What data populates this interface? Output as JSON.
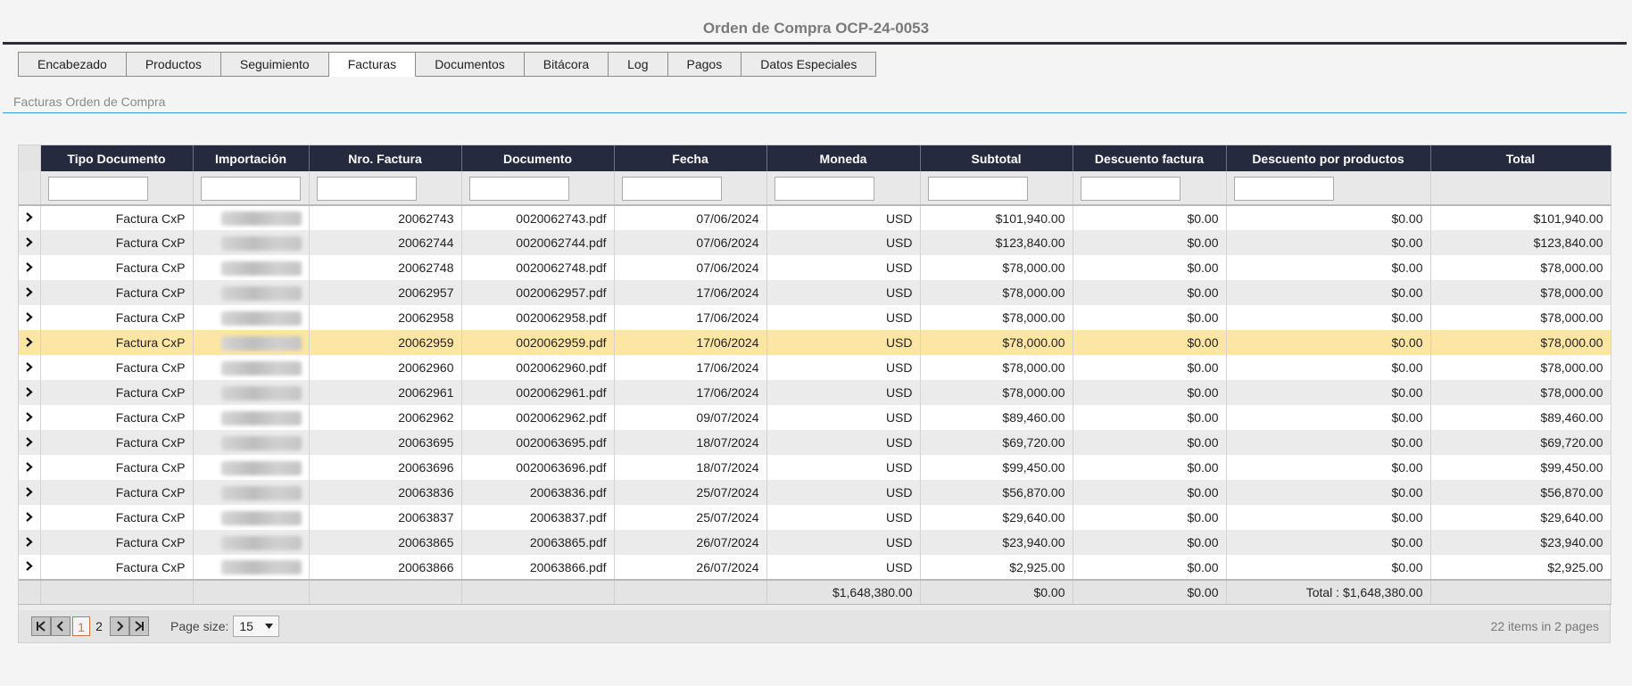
{
  "page": {
    "title": "Orden de Compra OCP-24-0053"
  },
  "tabs": [
    {
      "label": "Encabezado"
    },
    {
      "label": "Productos"
    },
    {
      "label": "Seguimiento"
    },
    {
      "label": "Facturas",
      "active": true
    },
    {
      "label": "Documentos"
    },
    {
      "label": "Bitácora"
    },
    {
      "label": "Log"
    },
    {
      "label": "Pagos"
    },
    {
      "label": "Datos Especiales"
    }
  ],
  "section": {
    "title": "Facturas Orden de Compra"
  },
  "grid": {
    "columns": [
      "Tipo Documento",
      "Importación",
      "Nro. Factura",
      "Documento",
      "Fecha",
      "Moneda",
      "Subtotal",
      "Descuento factura",
      "Descuento por productos",
      "Total"
    ],
    "expand_icon": "chevron-right-icon",
    "rows": [
      [
        "Factura CxP",
        "",
        "20062743",
        "0020062743.pdf",
        "07/06/2024",
        "USD",
        "$101,940.00",
        "$0.00",
        "$0.00",
        "$101,940.00"
      ],
      [
        "Factura CxP",
        "",
        "20062744",
        "0020062744.pdf",
        "07/06/2024",
        "USD",
        "$123,840.00",
        "$0.00",
        "$0.00",
        "$123,840.00"
      ],
      [
        "Factura CxP",
        "",
        "20062748",
        "0020062748.pdf",
        "07/06/2024",
        "USD",
        "$78,000.00",
        "$0.00",
        "$0.00",
        "$78,000.00"
      ],
      [
        "Factura CxP",
        "",
        "20062957",
        "0020062957.pdf",
        "17/06/2024",
        "USD",
        "$78,000.00",
        "$0.00",
        "$0.00",
        "$78,000.00"
      ],
      [
        "Factura CxP",
        "",
        "20062958",
        "0020062958.pdf",
        "17/06/2024",
        "USD",
        "$78,000.00",
        "$0.00",
        "$0.00",
        "$78,000.00"
      ],
      [
        "Factura CxP",
        "",
        "20062959",
        "0020062959.pdf",
        "17/06/2024",
        "USD",
        "$78,000.00",
        "$0.00",
        "$0.00",
        "$78,000.00"
      ],
      [
        "Factura CxP",
        "",
        "20062960",
        "0020062960.pdf",
        "17/06/2024",
        "USD",
        "$78,000.00",
        "$0.00",
        "$0.00",
        "$78,000.00"
      ],
      [
        "Factura CxP",
        "",
        "20062961",
        "0020062961.pdf",
        "17/06/2024",
        "USD",
        "$78,000.00",
        "$0.00",
        "$0.00",
        "$78,000.00"
      ],
      [
        "Factura CxP",
        "",
        "20062962",
        "0020062962.pdf",
        "09/07/2024",
        "USD",
        "$89,460.00",
        "$0.00",
        "$0.00",
        "$89,460.00"
      ],
      [
        "Factura CxP",
        "",
        "20063695",
        "0020063695.pdf",
        "18/07/2024",
        "USD",
        "$69,720.00",
        "$0.00",
        "$0.00",
        "$69,720.00"
      ],
      [
        "Factura CxP",
        "",
        "20063696",
        "0020063696.pdf",
        "18/07/2024",
        "USD",
        "$99,450.00",
        "$0.00",
        "$0.00",
        "$99,450.00"
      ],
      [
        "Factura CxP",
        "",
        "20063836",
        "20063836.pdf",
        "25/07/2024",
        "USD",
        "$56,870.00",
        "$0.00",
        "$0.00",
        "$56,870.00"
      ],
      [
        "Factura CxP",
        "",
        "20063837",
        "20063837.pdf",
        "25/07/2024",
        "USD",
        "$29,640.00",
        "$0.00",
        "$0.00",
        "$29,640.00"
      ],
      [
        "Factura CxP",
        "",
        "20063865",
        "20063865.pdf",
        "26/07/2024",
        "USD",
        "$23,940.00",
        "$0.00",
        "$0.00",
        "$23,940.00"
      ],
      [
        "Factura CxP",
        "",
        "20063866",
        "20063866.pdf",
        "26/07/2024",
        "USD",
        "$2,925.00",
        "$0.00",
        "$0.00",
        "$2,925.00"
      ]
    ],
    "selected_row_index": 5,
    "totals": {
      "subtotal": "$1,648,380.00",
      "descuento_factura": "$0.00",
      "descuento_productos": "$0.00",
      "total": "Total : $1,648,380.00"
    }
  },
  "pager": {
    "first_icon": "first-page-icon",
    "prev_icon": "prev-page-icon",
    "next_icon": "next-page-icon",
    "last_icon": "last-page-icon",
    "pages": [
      "1",
      "2"
    ],
    "current_page": "1",
    "page_size_label": "Page size:",
    "page_size": "15",
    "info": "22 items in 2 pages"
  },
  "colors": {
    "header_bg": "#252a3f",
    "selected_row": "#fde6a3",
    "accent_rule": "#3b9bd4",
    "current_page": "#d2703b"
  }
}
